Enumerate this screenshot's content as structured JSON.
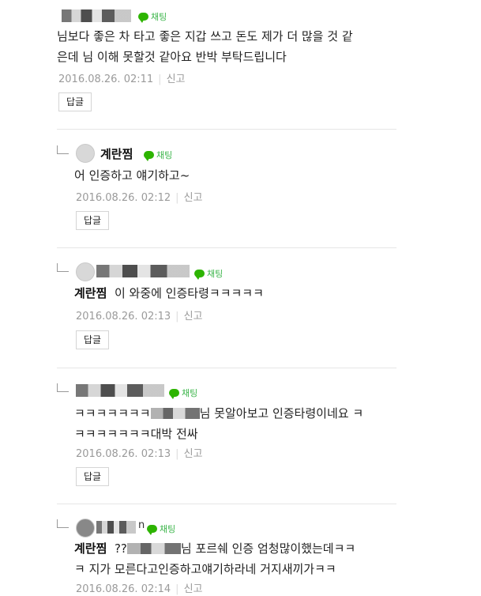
{
  "chat_label": "채팅",
  "report_label": "신고",
  "reply_label": "답글",
  "comments": [
    {
      "nickname_blurred": true,
      "text_line1": "님보다 좋은 차 타고 좋은 지갑 쓰고 돈도 제가 더 많을 것 같",
      "text_line2": "은데 님 이해 못할것 같아요 반박 부탁드립니다",
      "timestamp": "2016.08.26. 02:11"
    }
  ],
  "replies": [
    {
      "nickname": "계란찜",
      "text_line1": "어 인증하고 얘기하고~",
      "timestamp": "2016.08.26. 02:12"
    },
    {
      "nickname_blurred": true,
      "mention": "계란찜",
      "text_line1": "이 와중에 인증타령ㅋㅋㅋㅋㅋ",
      "timestamp": "2016.08.26. 02:13"
    },
    {
      "nickname_blurred": true,
      "text_line1_a": "ㅋㅋㅋㅋㅋㅋㅋ",
      "text_line1_b": "님 못알아보고 인증타령이네요 ㅋ",
      "text_line2": "ㅋㅋㅋㅋㅋㅋㅋ대박 전싸",
      "timestamp": "2016.08.26. 02:13"
    },
    {
      "nickname_blurred": true,
      "nick_suffix": "n",
      "mention": "계란찜",
      "text_line1_a": "??",
      "text_line1_b": "님 포르쉐 인증 엄청많이했는데ㅋㅋ",
      "text_line2": "ㅋ 지가 모른다고인증하고얘기하라네 거지새끼가ㅋㅋ",
      "timestamp": "2016.08.26. 02:14"
    }
  ]
}
